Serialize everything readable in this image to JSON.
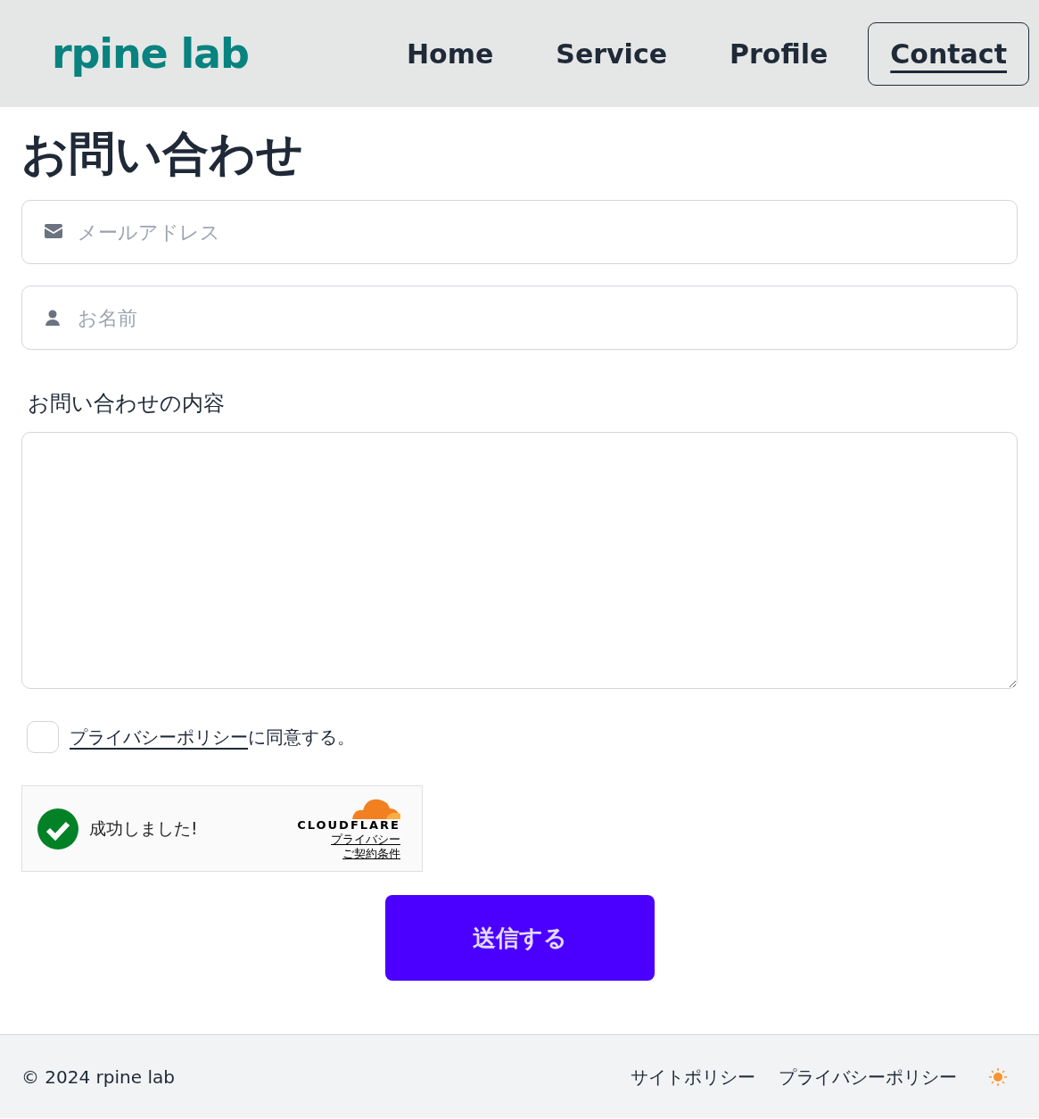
{
  "header": {
    "logo": "rpine lab",
    "nav": [
      {
        "label": "Home",
        "selected": false
      },
      {
        "label": "Service",
        "selected": false
      },
      {
        "label": "Profile",
        "selected": false
      },
      {
        "label": "Contact",
        "selected": true
      }
    ]
  },
  "form": {
    "title": "お問い合わせ",
    "fields": [
      {
        "kind": "email",
        "placeholder": "メールアドレス"
      },
      {
        "kind": "name",
        "placeholder": "お名前"
      }
    ],
    "message_label": "お問い合わせの内容",
    "agree": {
      "checked": false,
      "link": "プライバシーポリシー",
      "text": "に同意する。"
    },
    "captcha": {
      "status": "成功しました!",
      "brand": "CLOUDFLARE",
      "links": [
        "プライバシー",
        "ご契約条件"
      ]
    },
    "submit": "送信する"
  },
  "footer": {
    "copyright": "© 2024 rpine lab",
    "links": [
      "サイトポリシー",
      "プライバシーポリシー"
    ]
  }
}
